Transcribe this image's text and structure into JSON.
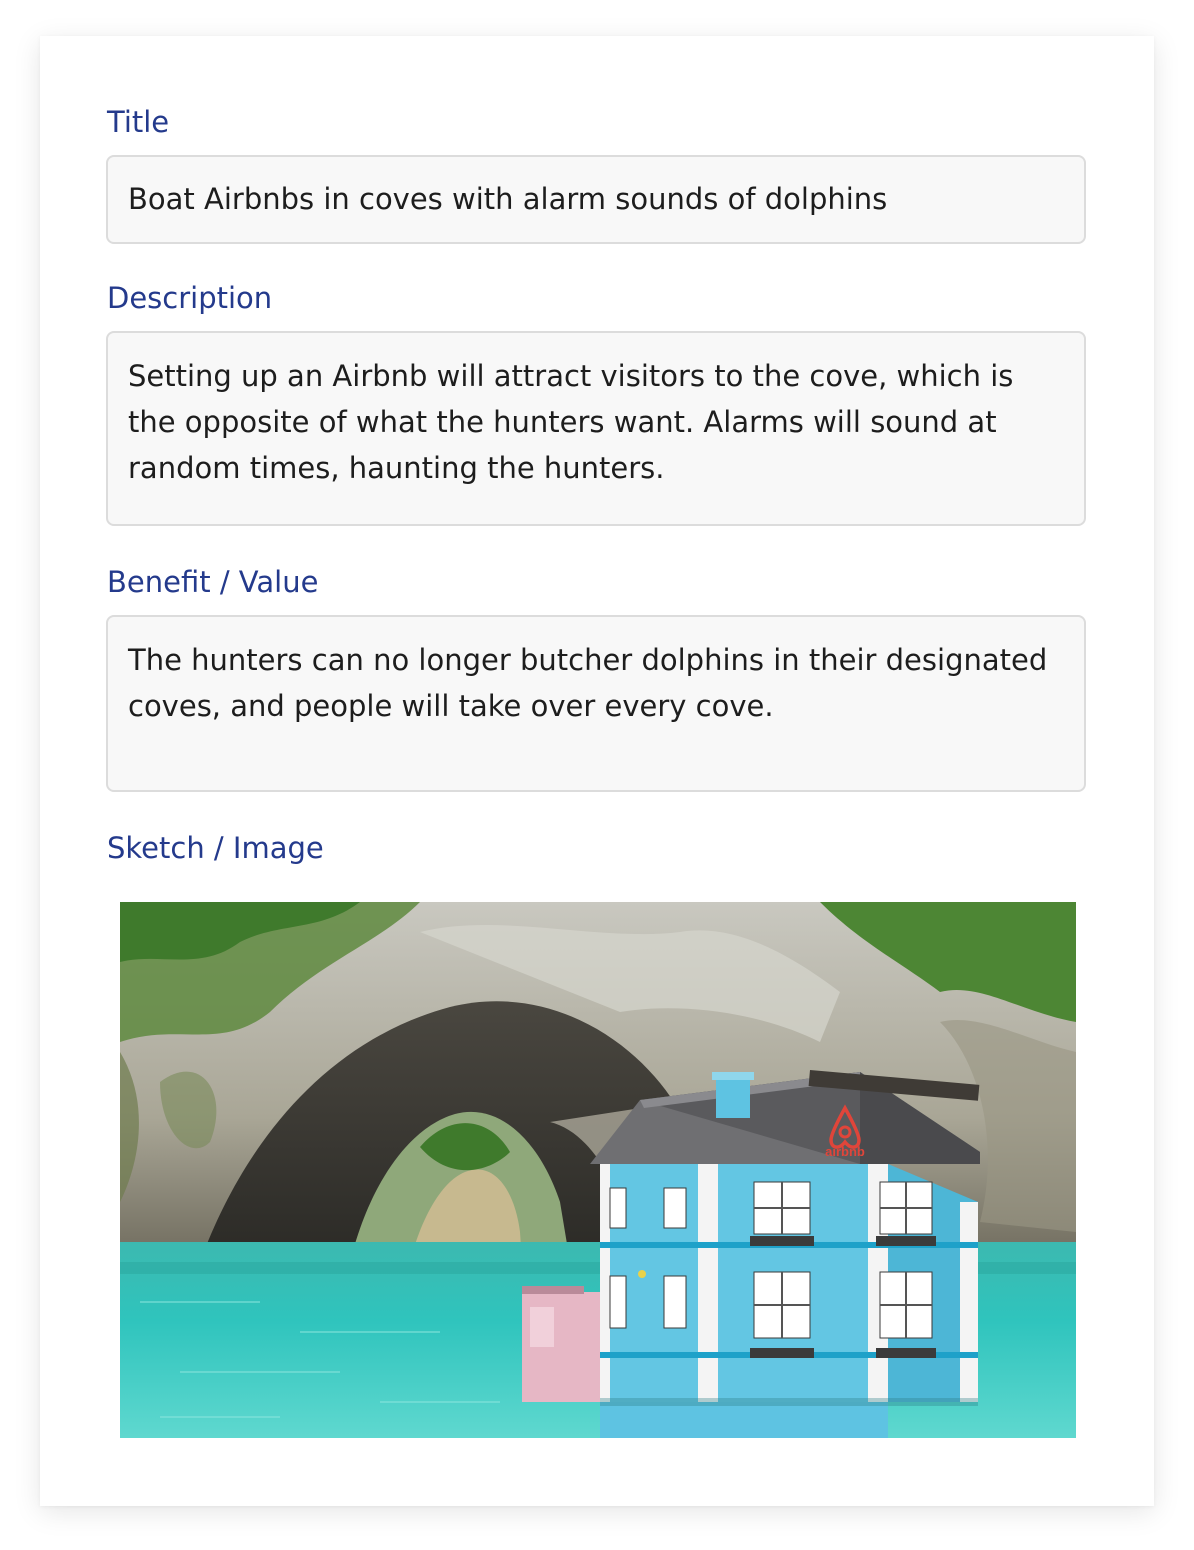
{
  "form": {
    "title": {
      "label": "Title",
      "value": "Boat Airbnbs in coves with alarm sounds of dolphins"
    },
    "description": {
      "label": "Description",
      "value": "Setting up an Airbnb will attract visitors to the cove, which is the opposite of what the hunters want. Alarms will sound at random times, haunting the hunters."
    },
    "benefit": {
      "label": "Benefit / Value",
      "value": "The hunters can no longer butcher dolphins in their designated coves, and people will take over every cove."
    },
    "sketch": {
      "label": "Sketch / Image",
      "logo_text": "airbnb"
    }
  },
  "colors": {
    "label": "#243a8c",
    "field_bg": "#f8f8f8",
    "field_border": "#dcdcdc",
    "water": "#2fc2bd",
    "house": "#63c6e3",
    "logo": "#e0453a"
  }
}
